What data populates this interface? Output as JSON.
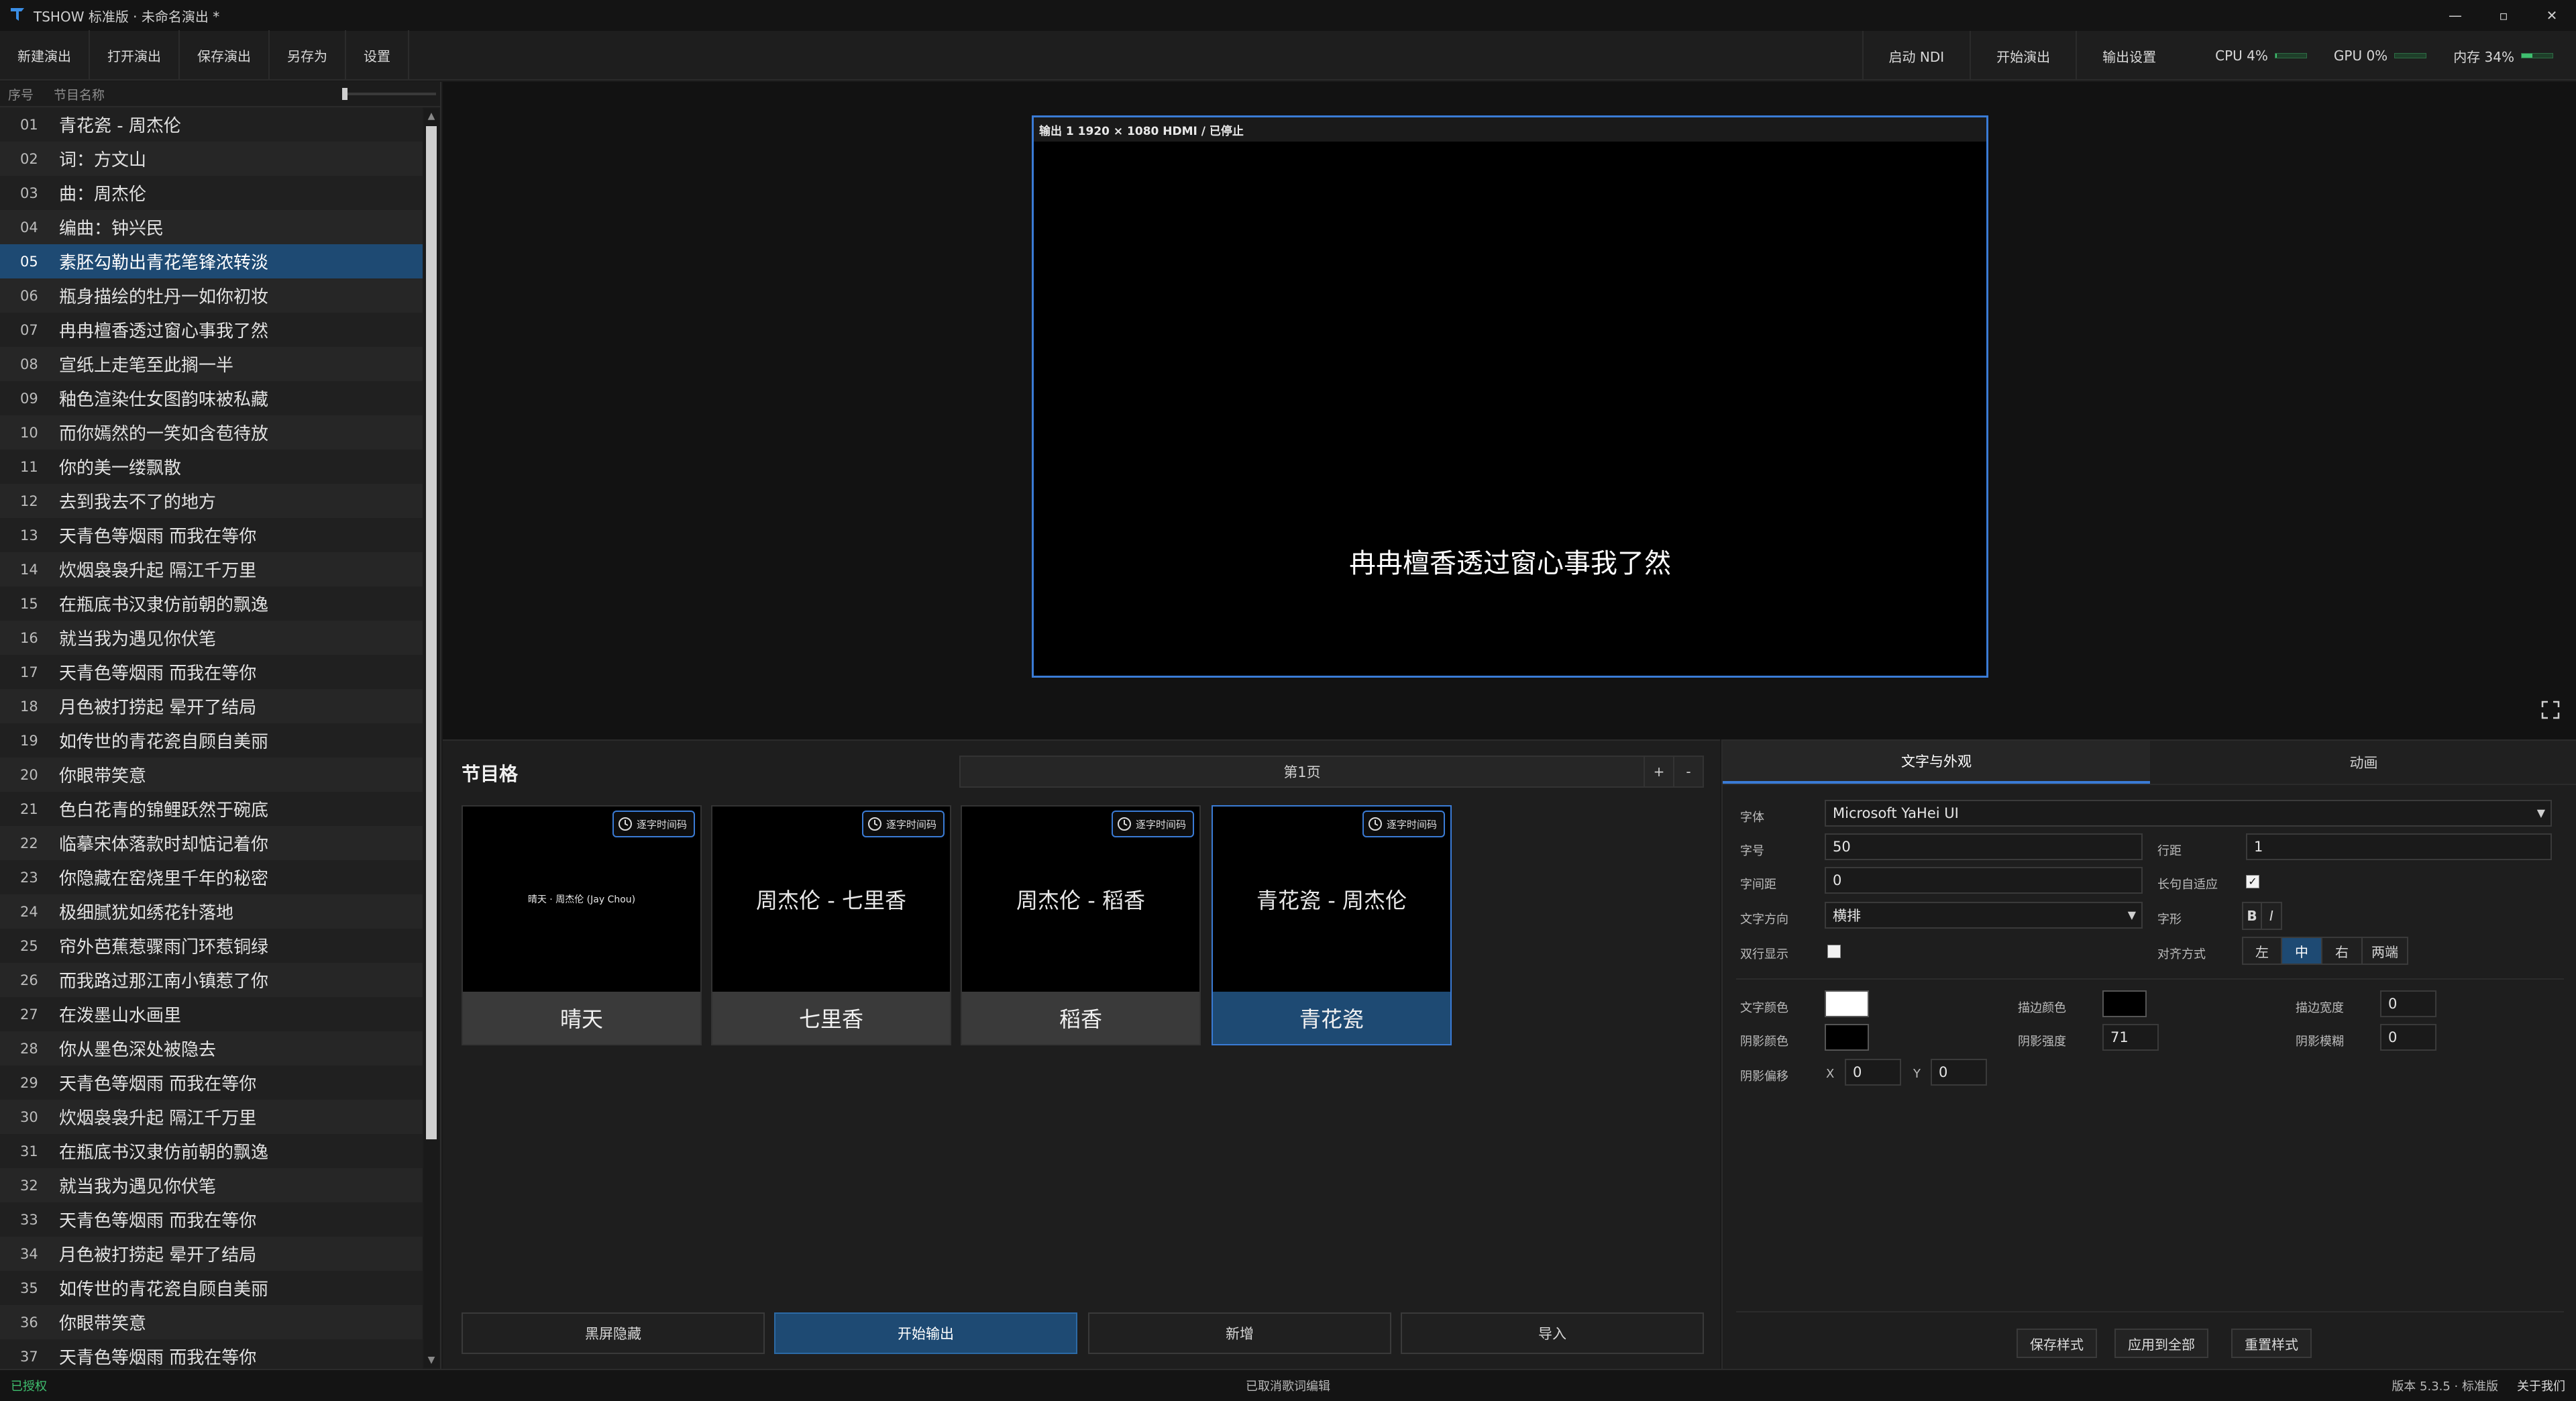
{
  "app": {
    "title": "TSHOW 标准版 · 未命名演出 *",
    "window_controls": [
      "—",
      "▫",
      "✕"
    ]
  },
  "toolbar": {
    "new": "新建演出",
    "open": "打开演出",
    "save": "保存演出",
    "save_as": "另存为",
    "settings": "设置",
    "ndi": "启动 NDI",
    "start_show": "开始演出",
    "output_settings": "输出设置",
    "cpu": "CPU 4%",
    "cpu_level": 0.04,
    "gpu": "GPU 0%",
    "gpu_level": 0.0,
    "mem": "内存 34%",
    "mem_level": 0.34
  },
  "list": {
    "col_no": "序号",
    "col_name": "节目名称",
    "selected_index": 4,
    "rows": [
      {
        "no": "01",
        "text": "青花瓷 - 周杰伦"
      },
      {
        "no": "02",
        "text": "词：方文山"
      },
      {
        "no": "03",
        "text": "曲：周杰伦"
      },
      {
        "no": "04",
        "text": "编曲：钟兴民"
      },
      {
        "no": "05",
        "text": "素胚勾勒出青花笔锋浓转淡"
      },
      {
        "no": "06",
        "text": "瓶身描绘的牡丹一如你初妆"
      },
      {
        "no": "07",
        "text": "冉冉檀香透过窗心事我了然"
      },
      {
        "no": "08",
        "text": "宣纸上走笔至此搁一半"
      },
      {
        "no": "09",
        "text": "釉色渲染仕女图韵味被私藏"
      },
      {
        "no": "10",
        "text": "而你嫣然的一笑如含苞待放"
      },
      {
        "no": "11",
        "text": "你的美一缕飘散"
      },
      {
        "no": "12",
        "text": "去到我去不了的地方"
      },
      {
        "no": "13",
        "text": "天青色等烟雨 而我在等你"
      },
      {
        "no": "14",
        "text": "炊烟袅袅升起 隔江千万里"
      },
      {
        "no": "15",
        "text": "在瓶底书汉隶仿前朝的飘逸"
      },
      {
        "no": "16",
        "text": "就当我为遇见你伏笔"
      },
      {
        "no": "17",
        "text": "天青色等烟雨 而我在等你"
      },
      {
        "no": "18",
        "text": "月色被打捞起 晕开了结局"
      },
      {
        "no": "19",
        "text": "如传世的青花瓷自顾自美丽"
      },
      {
        "no": "20",
        "text": "你眼带笑意"
      },
      {
        "no": "21",
        "text": "色白花青的锦鲤跃然于碗底"
      },
      {
        "no": "22",
        "text": "临摹宋体落款时却惦记着你"
      },
      {
        "no": "23",
        "text": "你隐藏在窑烧里千年的秘密"
      },
      {
        "no": "24",
        "text": "极细腻犹如绣花针落地"
      },
      {
        "no": "25",
        "text": "帘外芭蕉惹骤雨门环惹铜绿"
      },
      {
        "no": "26",
        "text": "而我路过那江南小镇惹了你"
      },
      {
        "no": "27",
        "text": "在泼墨山水画里"
      },
      {
        "no": "28",
        "text": "你从墨色深处被隐去"
      },
      {
        "no": "29",
        "text": "天青色等烟雨 而我在等你"
      },
      {
        "no": "30",
        "text": "炊烟袅袅升起 隔江千万里"
      },
      {
        "no": "31",
        "text": "在瓶底书汉隶仿前朝的飘逸"
      },
      {
        "no": "32",
        "text": "就当我为遇见你伏笔"
      },
      {
        "no": "33",
        "text": "天青色等烟雨 而我在等你"
      },
      {
        "no": "34",
        "text": "月色被打捞起 晕开了结局"
      },
      {
        "no": "35",
        "text": "如传世的青花瓷自顾自美丽"
      },
      {
        "no": "36",
        "text": "你眼带笑意"
      },
      {
        "no": "37",
        "text": "天青色等烟雨 而我在等你"
      }
    ]
  },
  "preview": {
    "header": "输出 1  1920 × 1080  HDMI / 已停止",
    "text": "冉冉檀香透过窗心事我了然"
  },
  "grid": {
    "title": "节目格",
    "page_label": "第1页",
    "add_page": "+",
    "remove_page": "-",
    "badge": "逐字时间码",
    "cards": [
      {
        "thumb": "晴天 · 周杰伦 (Jay Chou)",
        "name": "晴天",
        "small": true
      },
      {
        "thumb": "周杰伦 - 七里香",
        "name": "七里香",
        "small": false
      },
      {
        "thumb": "周杰伦 - 稻香",
        "name": "稻香",
        "small": false
      },
      {
        "thumb": "青花瓷 - 周杰伦",
        "name": "青花瓷",
        "small": false
      }
    ],
    "actions": {
      "blackout": "黑屏隐藏",
      "start_output": "开始输出",
      "add": "新增",
      "import": "导入"
    }
  },
  "style": {
    "tab_text": "文字与外观",
    "tab_anim": "动画",
    "font_label": "字体",
    "font_value": "Microsoft YaHei UI",
    "size_label": "字号",
    "size_value": "50",
    "line_label": "行距",
    "line_value": "1",
    "spacing_label": "字间距",
    "spacing_value": "0",
    "autofit_label": "长句自适应",
    "autofit_checked": "✓",
    "direction_label": "文字方向",
    "direction_value": "横排",
    "shape_label": "字形",
    "bold": "B",
    "italic": "I",
    "double_label": "双行显示",
    "align_label": "对齐方式",
    "align_left": "左",
    "align_center": "中",
    "align_right": "右",
    "align_justify": "两端",
    "text_color_label": "文字颜色",
    "text_color": "#ffffff",
    "stroke_color_label": "描边颜色",
    "stroke_color": "#000000",
    "stroke_width_label": "描边宽度",
    "stroke_width": "0",
    "shadow_color_label": "阴影颜色",
    "shadow_color": "#000000",
    "shadow_strength_label": "阴影强度",
    "shadow_strength": "71",
    "shadow_blur_label": "阴影模糊",
    "shadow_blur": "0",
    "shadow_offset_label": "阴影偏移",
    "x_label": "X",
    "x_value": "0",
    "y_label": "Y",
    "y_value": "0",
    "save_style": "保存样式",
    "apply_all": "应用到全部",
    "reset_style": "重置样式"
  },
  "status": {
    "license": "已授权",
    "message": "已取消歌词编辑",
    "version": "版本 5.3.5 · 标准版",
    "about": "关于我们"
  },
  "colors": {
    "accent": "#3a7bd5",
    "selected": "#1e4a73",
    "ok": "#3fbf6f"
  }
}
